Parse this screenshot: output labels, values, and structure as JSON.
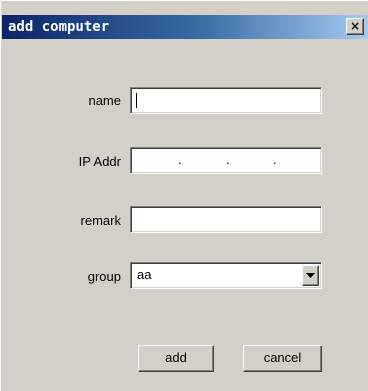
{
  "window": {
    "title": "add computer",
    "close_label": "×",
    "title_bar_color": "#0a246a",
    "background_color": "#d4d0c8"
  },
  "form": {
    "name": {
      "label": "name",
      "value": ""
    },
    "ip": {
      "label": "IP Addr",
      "dots": [
        ".",
        ".",
        "."
      ]
    },
    "remark": {
      "label": "remark",
      "value": ""
    },
    "group": {
      "label": "group",
      "selected": "aa"
    }
  },
  "buttons": {
    "add_label": "add",
    "cancel_label": "cancel"
  }
}
